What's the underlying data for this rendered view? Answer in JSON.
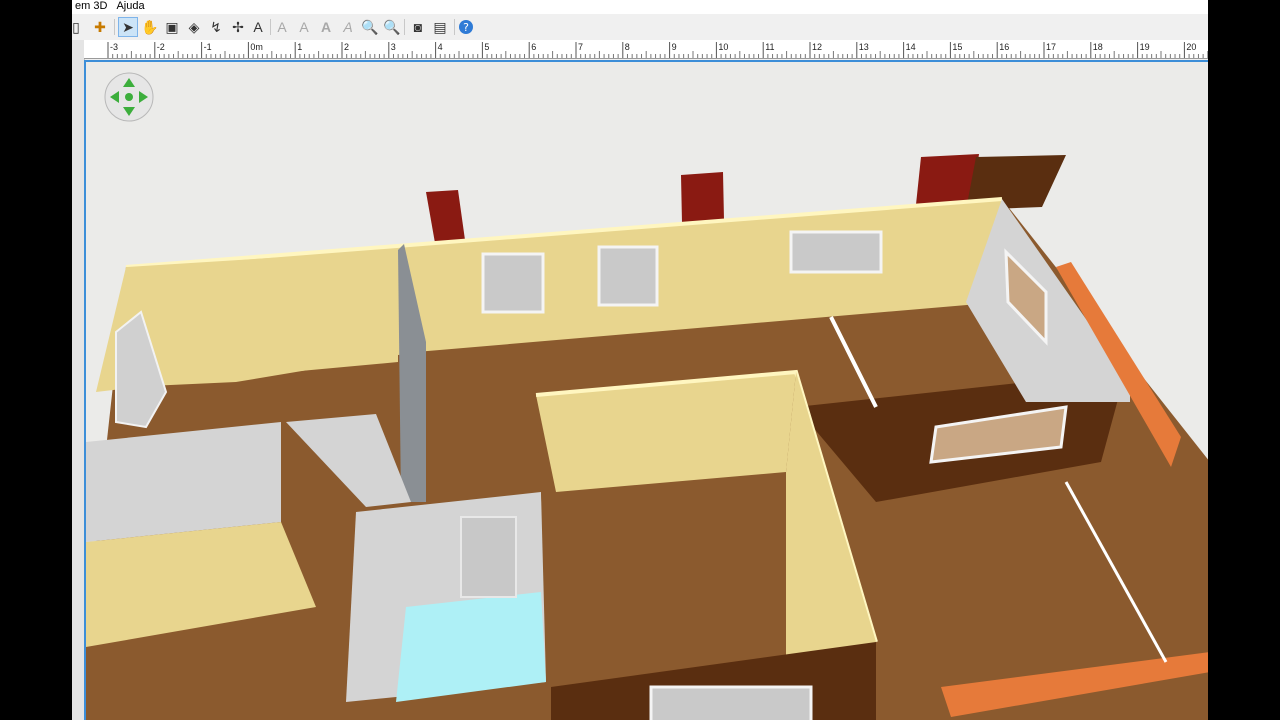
{
  "menu": {
    "item_3d": "em 3D",
    "item_help": "Ajuda"
  },
  "toolbar": {
    "buttons": [
      {
        "icon": "page-icon"
      },
      {
        "icon": "add-furniture-icon"
      },
      {
        "icon": "select-arrow-icon",
        "active": true
      },
      {
        "icon": "pan-hand-icon"
      },
      {
        "icon": "create-rooms-icon"
      },
      {
        "icon": "create-walls-icon"
      },
      {
        "icon": "create-polylines-icon"
      },
      {
        "icon": "create-dimensions-icon"
      },
      {
        "icon": "add-text-icon"
      },
      {
        "icon": "increase-text-icon"
      },
      {
        "icon": "decrease-text-icon"
      },
      {
        "icon": "bold-text-icon"
      },
      {
        "icon": "italic-text-icon"
      },
      {
        "icon": "zoom-in-icon"
      },
      {
        "icon": "zoom-out-icon"
      },
      {
        "icon": "create-photo-icon"
      },
      {
        "icon": "create-video-icon"
      },
      {
        "icon": "help-icon"
      }
    ]
  },
  "ruler": {
    "labels": [
      "-3",
      "-2",
      "-1",
      "0m",
      "1",
      "2",
      "3",
      "4",
      "5",
      "6",
      "7",
      "8",
      "9",
      "10",
      "11",
      "12",
      "13",
      "14",
      "15",
      "16",
      "17",
      "18",
      "19",
      "20"
    ]
  },
  "colors": {
    "wall_yellow": "#e8d58e",
    "wall_top": "#fff6c0",
    "floor": "#8b5a2e",
    "wall_brown": "#5a2e10",
    "chimney_red": "#8a1a12",
    "brick_orange": "#e67a3a",
    "bath_floor": "#aef0f6",
    "interior_gray": "#d4d4d4",
    "selection_blue": "#3c8ed8"
  }
}
